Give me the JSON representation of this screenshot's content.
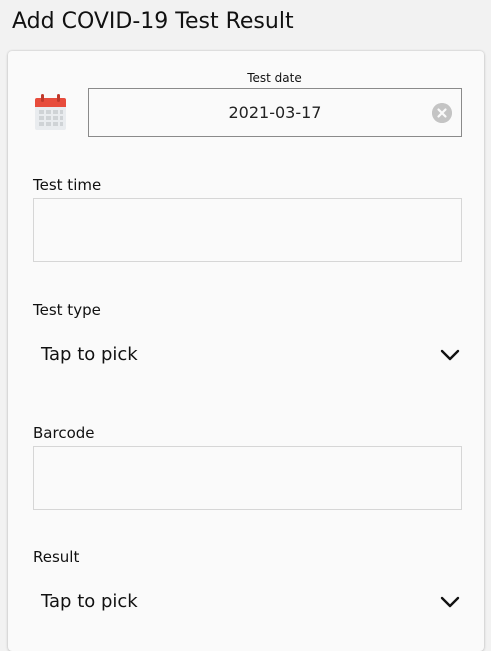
{
  "header": {
    "title": "Add COVID-19 Test Result"
  },
  "form": {
    "test_date": {
      "label": "Test date",
      "value": "2021-03-17"
    },
    "test_time": {
      "label": "Test time",
      "value": ""
    },
    "test_type": {
      "label": "Test type",
      "value": "Tap to pick"
    },
    "barcode": {
      "label": "Barcode",
      "value": ""
    },
    "result": {
      "label": "Result",
      "value": "Tap to pick"
    }
  },
  "colors": {
    "calendar_red": "#e74c3c",
    "calendar_grid": "#cfd3d6",
    "clear_button": "#c4c4c4"
  },
  "icons": [
    "calendar-icon",
    "clear-icon",
    "chevron-down-icon"
  ]
}
